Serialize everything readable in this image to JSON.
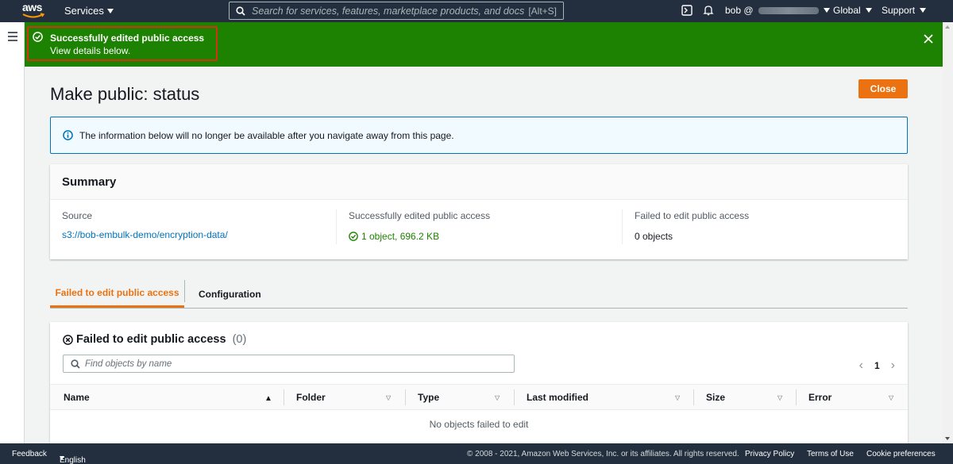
{
  "topnav": {
    "logo_text": "aws",
    "services_label": "Services",
    "search_placeholder": "Search for services, features, marketplace products, and docs",
    "search_shortcut": "[Alt+S]",
    "user_label": "bob @",
    "region_label": "Global",
    "support_label": "Support"
  },
  "flash": {
    "title": "Successfully edited public access",
    "subtitle": "View details below.",
    "color": "#1d8102",
    "highlight_color": "#d13212"
  },
  "page": {
    "title": "Make public: status",
    "close_label": "Close"
  },
  "info": {
    "text": "The information below will no longer be available after you navigate away from this page."
  },
  "summary": {
    "title": "Summary",
    "source_label": "Source",
    "source_value": "s3://bob-embulk-demo/encryption-data/",
    "success_label": "Successfully edited public access",
    "success_value": "1 object, 696.2 KB",
    "failed_label": "Failed to edit public access",
    "failed_value": "0 objects"
  },
  "tabs": [
    {
      "label": "Failed to edit public access",
      "active": true
    },
    {
      "label": "Configuration",
      "active": false
    }
  ],
  "table": {
    "title": "Failed to edit public access",
    "count": "(0)",
    "find_placeholder": "Find objects by name",
    "page_number": "1",
    "columns": [
      "Name",
      "Folder",
      "Type",
      "Last modified",
      "Size",
      "Error"
    ],
    "empty_text": "No objects failed to edit"
  },
  "footer": {
    "feedback": "Feedback",
    "language": "English (US)",
    "copyright": "© 2008 - 2021, Amazon Web Services, Inc. or its affiliates. All rights reserved.",
    "privacy": "Privacy Policy",
    "terms": "Terms of Use",
    "cookies": "Cookie preferences"
  }
}
